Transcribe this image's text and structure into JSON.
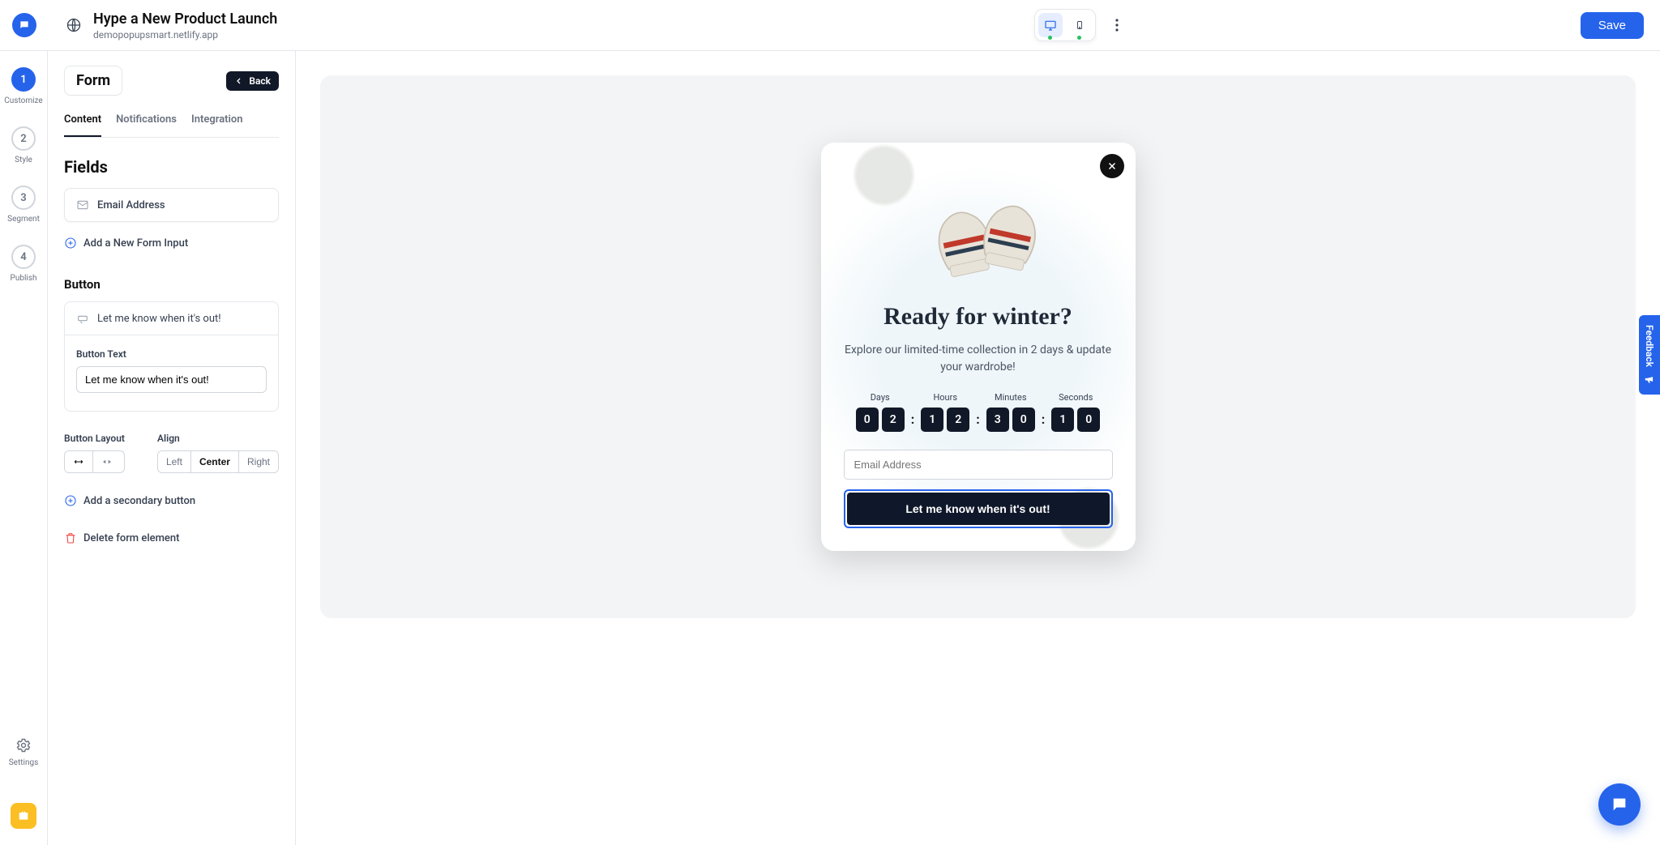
{
  "header": {
    "title": "Hype a New Product Launch",
    "domain": "demopopupsmart.netlify.app",
    "save_label": "Save"
  },
  "steps": [
    {
      "num": "1",
      "label": "Customize"
    },
    {
      "num": "2",
      "label": "Style"
    },
    {
      "num": "3",
      "label": "Segment"
    },
    {
      "num": "4",
      "label": "Publish"
    }
  ],
  "settings_label": "Settings",
  "sidebar": {
    "chip": "Form",
    "back": "Back",
    "tabs": [
      "Content",
      "Notifications",
      "Integration"
    ],
    "fields_heading": "Fields",
    "field_email": "Email Address",
    "add_input": "Add a New Form Input",
    "button_heading": "Button",
    "button_row_text": "Let me know when it's out!",
    "button_text_label": "Button Text",
    "button_text_value": "Let me know when it's out!",
    "layout_label": "Button Layout",
    "align_label": "Align",
    "align_opts": [
      "Left",
      "Center",
      "Right"
    ],
    "add_secondary": "Add a secondary button",
    "delete_element": "Delete form element"
  },
  "popup": {
    "title": "Ready for winter?",
    "body": "Explore our limited-time collection in 2 days & update your wardrobe!",
    "countdown_labels": [
      "Days",
      "Hours",
      "Minutes",
      "Seconds"
    ],
    "countdown": {
      "days": [
        "0",
        "2"
      ],
      "hours": [
        "1",
        "2"
      ],
      "minutes": [
        "3",
        "0"
      ],
      "seconds": [
        "1",
        "0"
      ]
    },
    "email_placeholder": "Email Address",
    "cta": "Let me know when it's out!"
  },
  "feedback_label": "Feedback"
}
